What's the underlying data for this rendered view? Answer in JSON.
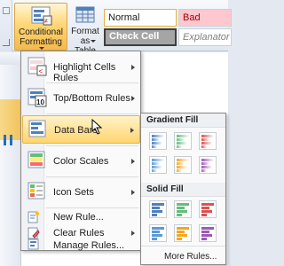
{
  "ribbon": {
    "conditional_formatting_label_1": "Conditional",
    "conditional_formatting_label_2": "Formatting",
    "format_as_table_label_1": "Format",
    "format_as_table_label_2": "as Table",
    "styles": {
      "normal": "Normal",
      "bad": "Bad",
      "check_cell": "Check Cell",
      "explanatory": "Explanator"
    }
  },
  "menu": {
    "items": [
      {
        "label": "Highlight Cells Rules",
        "icon": "highlight-cells-icon"
      },
      {
        "label": "Top/Bottom Rules",
        "icon": "top-bottom-icon"
      },
      {
        "label": "Data Bars",
        "icon": "data-bars-icon"
      },
      {
        "label": "Color Scales",
        "icon": "color-scales-icon"
      },
      {
        "label": "Icon Sets",
        "icon": "icon-sets-icon"
      },
      {
        "label": "New Rule..."
      },
      {
        "label": "Clear Rules"
      },
      {
        "label": "Manage Rules..."
      }
    ]
  },
  "submenu": {
    "gradient_header": "Gradient Fill",
    "solid_header": "Solid Fill",
    "more_rules": "More Rules...",
    "colors": [
      "#4f81bd",
      "#63be7b",
      "#d9534f",
      "#5b9bd5",
      "#f5a623",
      "#9b59b6"
    ]
  }
}
